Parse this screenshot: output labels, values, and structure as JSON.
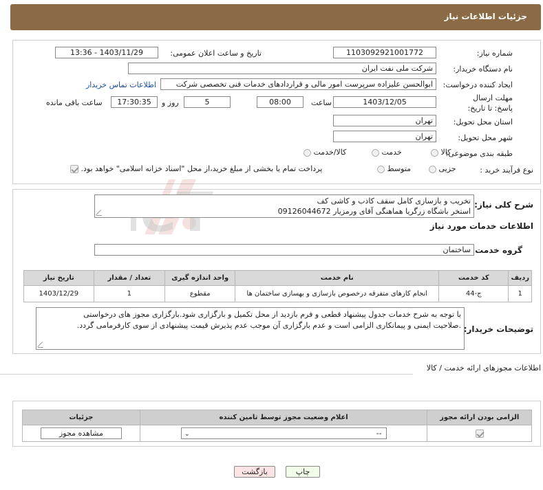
{
  "header": {
    "title": "جزئیات اطلاعات نیاز"
  },
  "form": {
    "need_number_label": "شماره نیاز:",
    "need_number": "1103092921001772",
    "announce_label": "تاریخ و ساعت اعلان عمومی:",
    "announce_value": "1403/11/29 - 13:36",
    "buyer_label": "نام دستگاه خریدار:",
    "buyer_value": "شرکت ملی نفت ایران",
    "creator_label": "ایجاد کننده درخواست:",
    "creator_value": "ابوالحسن علیزاده سرپرست امور مالی و قراردادهای خدمات فنی تخصصی شرکت",
    "contact_link": "اطلاعات تماس خریدار",
    "deadline_label": "مهلت ارسال پاسخ: تا تاریخ:",
    "deadline_date": "1403/12/05",
    "time_label": "ساعت",
    "deadline_time": "08:00",
    "days_value": "5",
    "days_label": "روز و",
    "remaining_time": "17:30:35",
    "remaining_label": "ساعت باقی مانده",
    "province_label": "استان محل تحویل:",
    "province_value": "تهران",
    "city_label": "شهر محل تحویل:",
    "city_value": "تهران",
    "category_label": "طبقه بندی موضوعی:",
    "category_options": [
      "کالا",
      "خدمت",
      "کالا/خدمت"
    ],
    "process_label": "نوع فرآیند خرید :",
    "process_options": [
      "جزیی",
      "متوسط"
    ],
    "payment_note": "پرداخت تمام یا بخشی از مبلغ خرید،از محل \"اسناد خزانه اسلامی\" خواهد بود."
  },
  "description": {
    "label": "شرح کلی نیاز:",
    "line1": "تخریب و بازسازی کامل سقف کاذب و کاشی کف",
    "line2": "استخر باشگاه زرگریا هماهنگی آقای ورمزیار 09126044672"
  },
  "services": {
    "section_title": "اطلاعات خدمات مورد نیاز",
    "group_label": "گروه خدمت:",
    "group_value": "ساختمان",
    "columns": [
      "ردیف",
      "کد خدمت",
      "نام خدمت",
      "واحد اندازه گیری",
      "تعداد / مقدار",
      "تاریخ نیاز"
    ],
    "rows": [
      [
        "1",
        "ج-44",
        "انجام کارهای متفرقه درخصوص بازسازی و بهسازی ساختمان ها",
        "مقطوع",
        "1",
        "1403/12/29"
      ]
    ]
  },
  "buyer_notes": {
    "label": "توضیحات خریدار:",
    "line1": "با توجه به شرح خدمات جدول پیشنهاد قطعی و فرم بازدید از محل تکمیل و بارگزاری شود.بارگزاری مجوز های درخواستی",
    "line2": ".صلاحیت ایمنی و پیمانکاری الزامی است و عدم بارگزاری آن موجب عدم پذیرش قیمت پیشنهادی  از سوی کارفرمامی گردد."
  },
  "permits": {
    "section_title": "اطلاعات مجوزهای ارائه خدمت / کالا",
    "columns": [
      "الزامی بودن ارائه مجوز",
      "اعلام وضعیت مجوز توسط تامین کننده",
      "جزئیات"
    ],
    "select_value": "--",
    "view_button": "مشاهده مجوز"
  },
  "actions": {
    "print": "چاپ",
    "back": "بازگشت"
  },
  "watermark": {
    "text": "AriaTender.neT"
  },
  "colors": {
    "header_bg": "#8a6b45",
    "link": "#1a4fa0",
    "back_btn_bg": "#fde4e4"
  }
}
